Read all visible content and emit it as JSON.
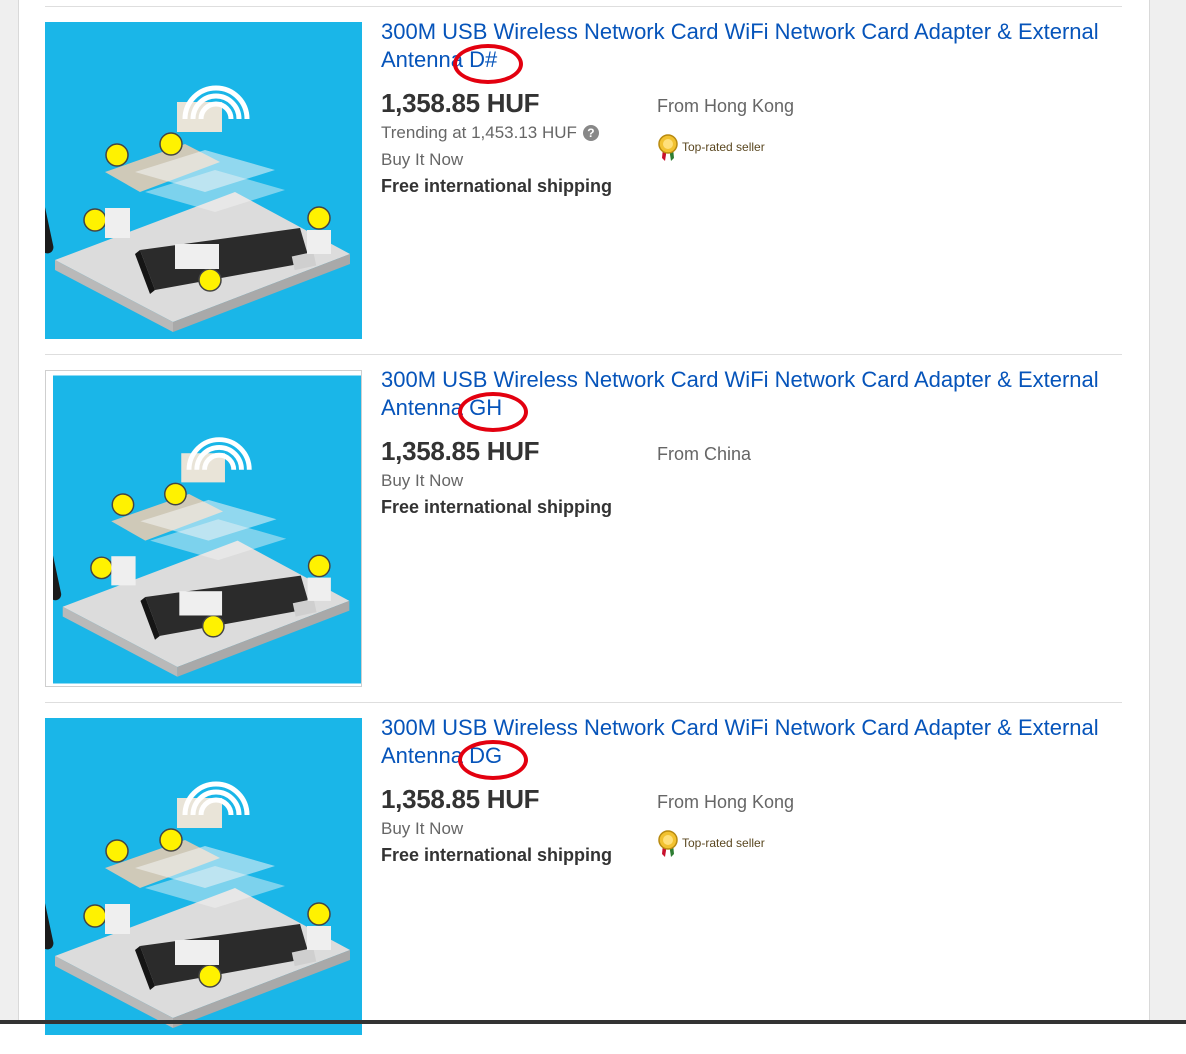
{
  "listings": [
    {
      "title": "300M USB Wireless Network Card WiFi Network Card Adapter & External Antenna D#",
      "price": "1,358.85 HUF",
      "trending": "Trending at 1,453.13 HUF",
      "format": "Buy It Now",
      "shipping": "Free international shipping",
      "origin": "From Hong Kong",
      "seller_badge": "Top-rated seller"
    },
    {
      "title": "300M USB Wireless Network Card WiFi Network Card Adapter & External Antenna GH",
      "price": "1,358.85 HUF",
      "format": "Buy It Now",
      "shipping": "Free international shipping",
      "origin": "From China"
    },
    {
      "title": "300M USB Wireless Network Card WiFi Network Card Adapter & External Antenna DG",
      "price": "1,358.85 HUF",
      "format": "Buy It Now",
      "shipping": "Free international shipping",
      "origin": "From Hong Kong",
      "seller_badge": "Top-rated seller"
    }
  ],
  "help_glyph": "?",
  "colors": {
    "link": "#0654ba",
    "price": "#333333",
    "muted": "#666666",
    "annotation": "#e3000f",
    "thumb_bg": "#1ab6e8"
  },
  "icons": {
    "help": "question-circle-icon",
    "badge": "top-rated-medal-icon"
  }
}
